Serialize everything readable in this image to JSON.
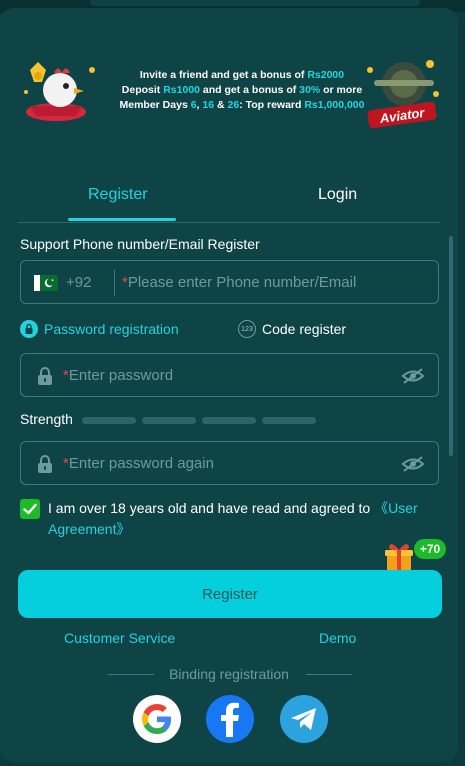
{
  "banner": {
    "line1_pre": "Invite a friend and get a bonus of ",
    "line1_amount": "Rs2000",
    "line2_pre": "Deposit ",
    "line2_amount": "Rs1000",
    "line2_mid": " and get a bonus of ",
    "line2_pct": "30%",
    "line2_post": " or more",
    "line3_pre": "Member Days ",
    "line3_d1": "6",
    "line3_sep1": ", ",
    "line3_d2": "16",
    "line3_sep2": " & ",
    "line3_d3": "26",
    "line3_mid": ": Top reward ",
    "line3_reward": "Rs1,000,000",
    "game_logo": "Aviator"
  },
  "tabs": {
    "register": "Register",
    "login": "Login",
    "active": "register"
  },
  "form": {
    "section_label": "Support Phone number/Email Register",
    "country_code": "+92",
    "required_mark": "*",
    "phone_placeholder": "Please enter Phone number/Email",
    "mode_password": "Password registration",
    "mode_code": "Code register",
    "code_badge": "123",
    "password_placeholder": "Enter password",
    "strength_label": "Strength",
    "strength_level": 0,
    "password_again_placeholder": "Enter password again",
    "agree_checked": true,
    "agree_text": "I am over 18 years old and have read and agreed to ",
    "agree_link": "《User Agreement》",
    "gift_bonus": "+70",
    "register_button": "Register"
  },
  "links": {
    "customer_service": "Customer Service",
    "demo": "Demo"
  },
  "binding": {
    "label": "Binding registration"
  },
  "colors": {
    "background": "#0f4447",
    "accent": "#22d3df",
    "button": "#05cfdc",
    "check": "#1dbb2a",
    "required": "#e44b4b"
  },
  "icons": [
    "pakistan-flag-icon",
    "lock-icon",
    "eye-off-icon",
    "google-icon",
    "facebook-icon",
    "telegram-icon",
    "gift-icon"
  ]
}
